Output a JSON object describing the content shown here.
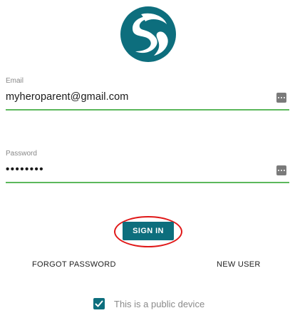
{
  "logo": {
    "icon": "brand-swirl-logo",
    "color": "#0d6e7d"
  },
  "email": {
    "label": "Email",
    "value": "myheroparent@gmail.com"
  },
  "password": {
    "label": "Password",
    "value": "••••••••"
  },
  "sign_in": {
    "label": "SIGN IN"
  },
  "links": {
    "forgot_password": "FORGOT PASSWORD",
    "new_user": "NEW USER"
  },
  "public_device": {
    "checked": true,
    "label": "This is a public device"
  },
  "colors": {
    "accent": "#0d6e7d",
    "field_underline": "#5cb85c",
    "highlight_ring": "#e01818"
  }
}
